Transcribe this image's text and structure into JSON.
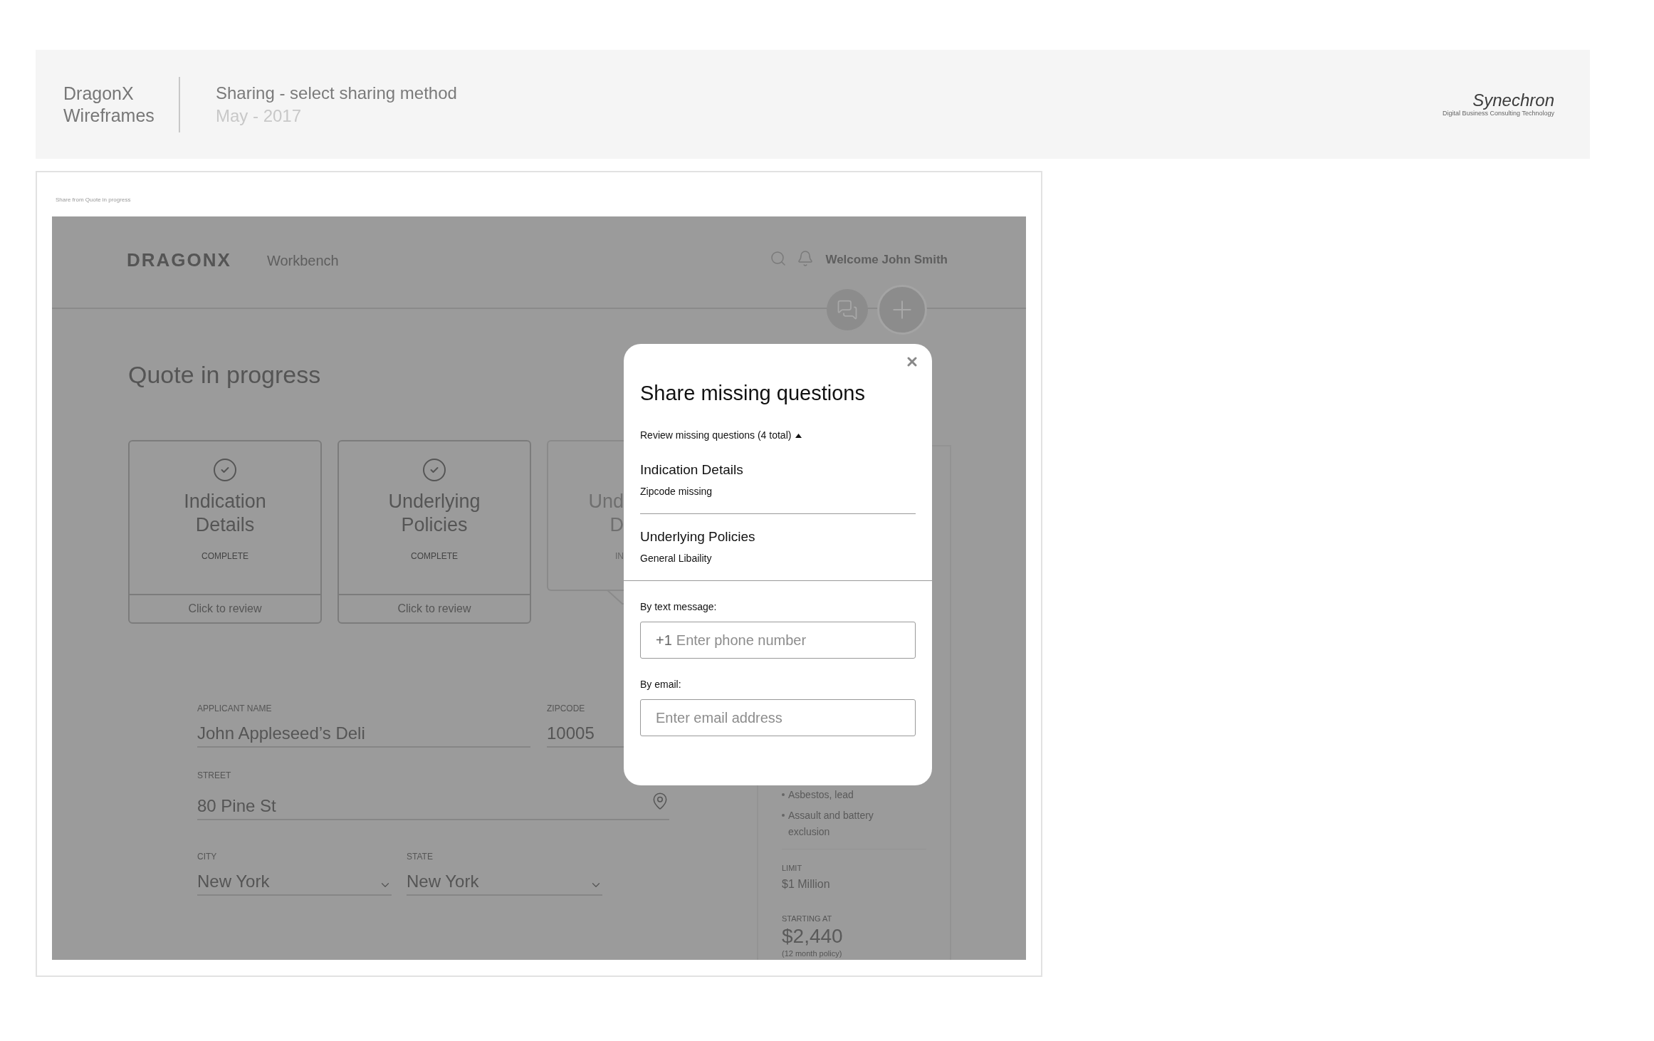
{
  "header": {
    "product": "DragonX Wireframes",
    "title": "Sharing - select sharing method",
    "date": "May - 2017",
    "logo": {
      "name": "Synechron",
      "tagline": "Digital Business Consulting Technology"
    }
  },
  "artboard": {
    "caption": "Share from Quote in progress"
  },
  "app": {
    "brand": "DRAGONX",
    "nav": "Workbench",
    "welcome": "Welcome John Smith",
    "page_title": "Quote in progress",
    "cards": [
      {
        "kind": "full",
        "title": "Indication Details",
        "status": "COMPLETE",
        "action": "Click to review"
      },
      {
        "kind": "full",
        "title": "Underlying Policies",
        "status": "COMPLETE",
        "action": "Click to review"
      },
      {
        "kind": "partial",
        "title": "Und",
        "title_2": "D",
        "status": "IN"
      }
    ],
    "form": [
      [
        {
          "kind": "text",
          "label": "APPLICANT NAME",
          "value": "John Appleseed’s Deli"
        },
        {
          "kind": "text",
          "label": "ZIPCODE",
          "value": "10005"
        }
      ],
      [
        {
          "kind": "address",
          "label": "STREET",
          "value": "80 Pine St"
        }
      ],
      [
        {
          "kind": "select",
          "label": "CITY",
          "value": "New York"
        },
        {
          "kind": "select",
          "label": "STATE",
          "value": "New York"
        }
      ]
    ],
    "summary": {
      "exclusions": [
        "Asbestos, lead",
        "Assault and battery exclusion"
      ],
      "limit_label": "LIMIT",
      "limit": "$1 Million",
      "price_label": "STARTING AT",
      "price": "$2,440",
      "price_note": "(12 month policy)"
    }
  },
  "modal": {
    "title": "Share missing questions",
    "review": {
      "label": "Review missing questions (4 total)",
      "expanded": true
    },
    "questions": [
      {
        "section": "Indication Details",
        "detail": "Zipcode missing"
      },
      {
        "section": "Underlying Policies",
        "detail": "General Libaility"
      }
    ],
    "methods": [
      {
        "label": "By text message:",
        "prefix": "+1",
        "placeholder": "Enter phone number"
      },
      {
        "label": "By email:",
        "placeholder": "Enter email address"
      }
    ]
  }
}
